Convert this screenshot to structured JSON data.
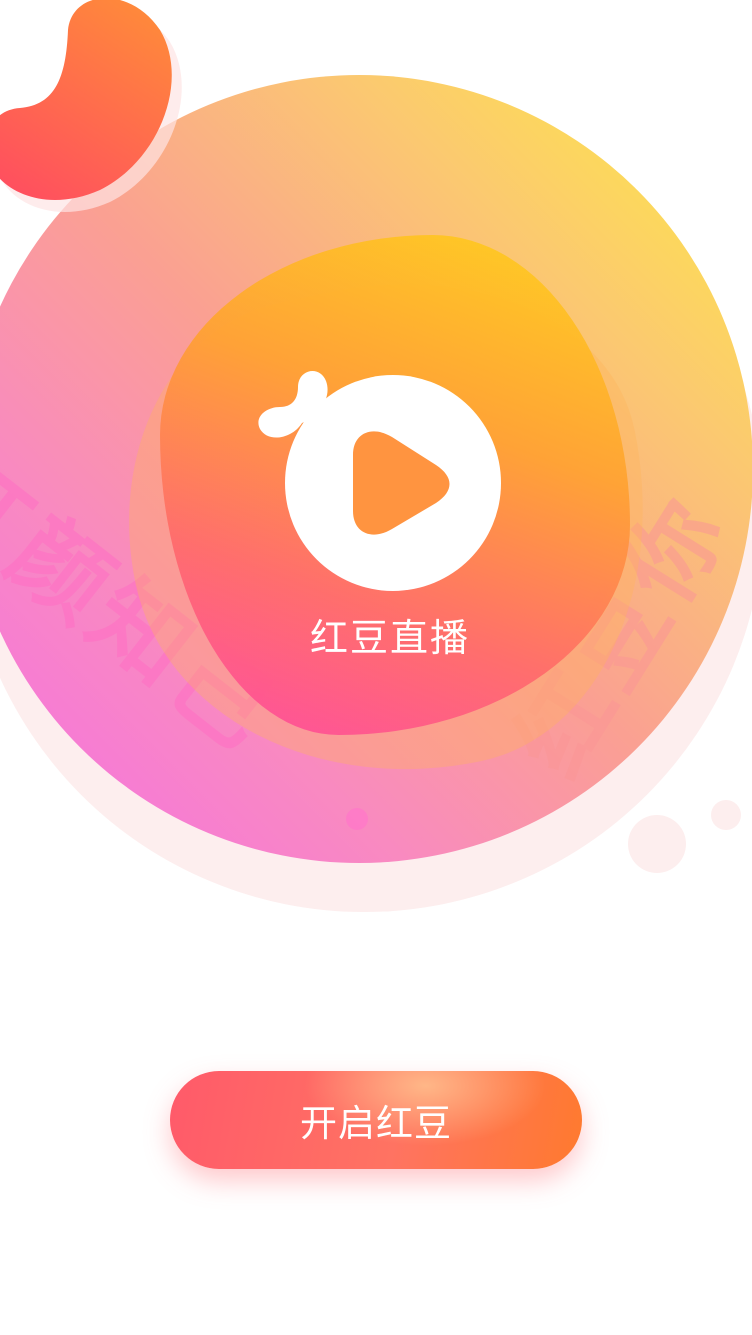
{
  "splash": {
    "app_name": "红豆直播",
    "background_text_left": "红颜知己",
    "background_text_right": "红豆你",
    "start_button_label": "开启红豆"
  },
  "colors": {
    "button_start": "#ff5a6a",
    "button_end": "#ff7a2e",
    "circle_yellow": "#feec42",
    "circle_pink": "#f46ee7",
    "blob_top": "#ffd21a",
    "blob_bottom": "#ff46a3",
    "bean": "#ff5f5f"
  },
  "icons": {
    "logo": "play-bean-logo-icon",
    "bean": "red-bean-icon"
  }
}
